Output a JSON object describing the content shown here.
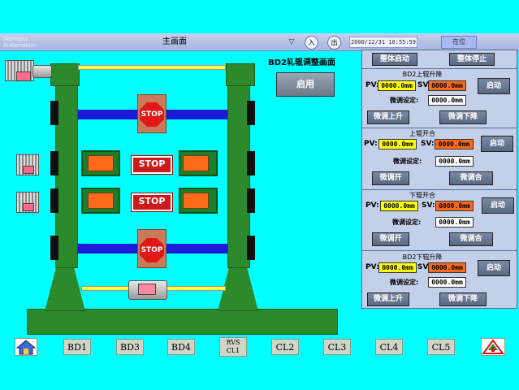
{
  "topbar": {
    "logo_line1": "Siemens",
    "logo_line2": "Automation",
    "screen_title": "主画面",
    "login_label": "入",
    "logout_label": "出",
    "clock": "2000/12/31  10:55:59",
    "user_label": "在位"
  },
  "diagram": {
    "stop_label": "STOP"
  },
  "screen": {
    "title": "BD2轧辊调整画面",
    "enable_label": "启用"
  },
  "panel": {
    "master_start": "整体启动",
    "master_stop": "整体停止",
    "sections": [
      {
        "title": "BD2上辊升降",
        "pv_label": "PV:",
        "pv": "0000.0mm",
        "sv_label": "SV:",
        "sv": "0000.0mm",
        "start": "启动",
        "fine_label": "微调设定:",
        "fine": "0000.0mm",
        "btn_left": "微调上升",
        "btn_right": "微调下降"
      },
      {
        "title": "上辊开合",
        "pv_label": "PV:",
        "pv": "0000.0mm",
        "sv_label": "SV:",
        "sv": "0000.0mm",
        "start": "启动",
        "fine_label": "微调设定:",
        "fine": "0000.0mm",
        "btn_left": "微调开",
        "btn_right": "微调合"
      },
      {
        "title": "下辊开合",
        "pv_label": "PV:",
        "pv": "0000.0mm",
        "sv_label": "SV:",
        "sv": "0000.0mm",
        "start": "启动",
        "fine_label": "微调设定:",
        "fine": "0000.0mm",
        "btn_left": "微调开",
        "btn_right": "微调合"
      },
      {
        "title": "BD2下辊升降",
        "pv_label": "PV:",
        "pv": "0000.0mm",
        "sv_label": "SV:",
        "sv": "0000.0mm",
        "start": "启动",
        "fine_label": "微调设定:",
        "fine": "0000.0mm",
        "btn_left": "微调上升",
        "btn_right": "微调下降"
      }
    ]
  },
  "nav": {
    "items": [
      "BD1",
      "BD3",
      "BD4",
      "RVS",
      "CL1",
      "CL2",
      "CL3",
      "CL4",
      "CL5"
    ]
  },
  "colors": {
    "background": "#00ffff",
    "frame": "#2c8a2c",
    "pv": "#ffff00",
    "sv": "#ff6a1a",
    "stop": "#cc1a1a"
  }
}
